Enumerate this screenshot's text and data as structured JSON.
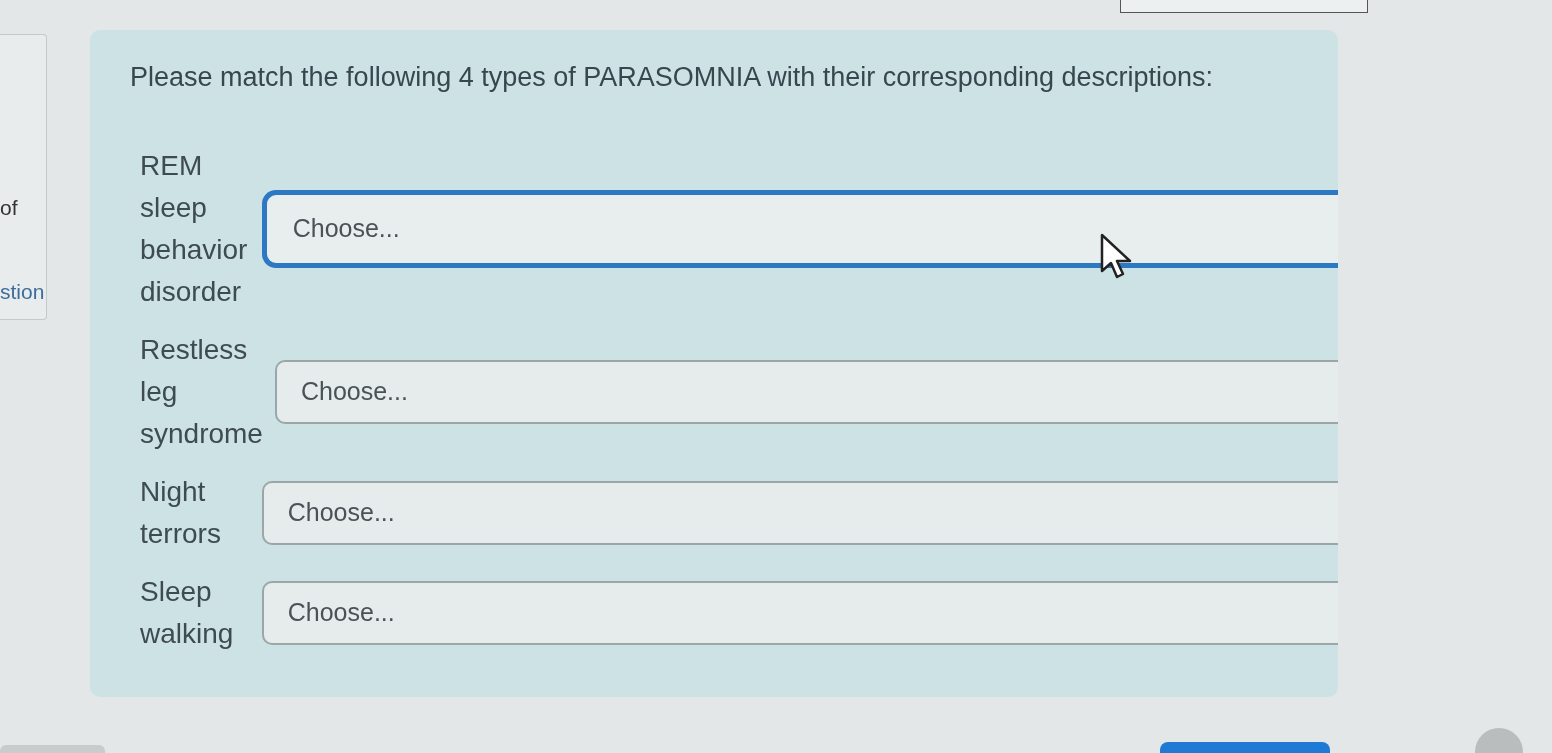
{
  "left_card": {
    "text": "of",
    "link": "stion"
  },
  "question": {
    "prompt": "Please match the following 4 types of PARASOMNIA with their corresponding descriptions:",
    "items": [
      {
        "term": "REM sleep behavior disorder",
        "select": {
          "value": "Choose...",
          "focused": true
        }
      },
      {
        "term": "Restless leg syndrome",
        "select": {
          "value": "Choose...",
          "focused": false
        }
      },
      {
        "term": "Night terrors",
        "select": {
          "value": "Choose...",
          "focused": false
        }
      },
      {
        "term": "Sleep walking",
        "select": {
          "value": "Choose...",
          "focused": false
        }
      }
    ]
  }
}
